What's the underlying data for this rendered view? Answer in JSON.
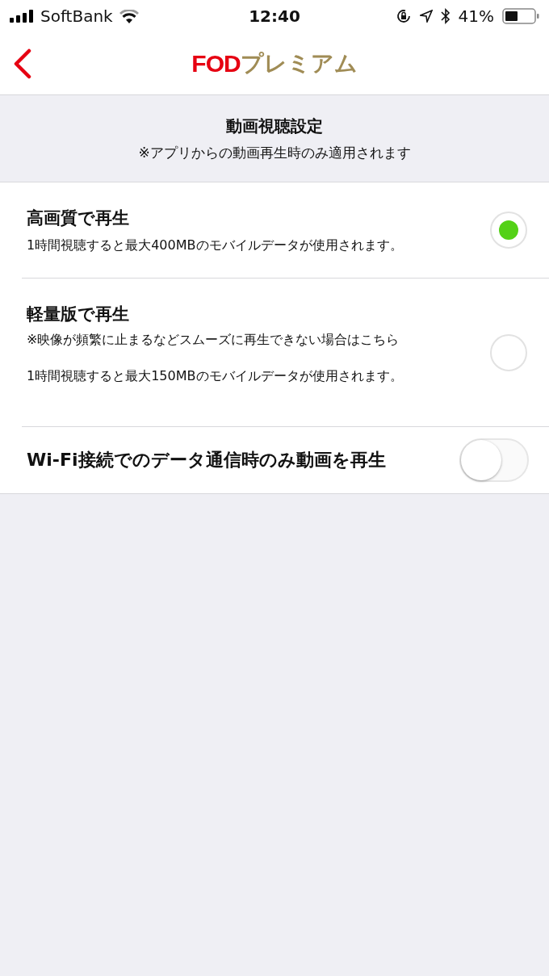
{
  "status_bar": {
    "carrier": "SoftBank",
    "time": "12:40",
    "battery": "41%"
  },
  "nav": {
    "logo_brand": "FOD",
    "logo_suffix": "プレミアム"
  },
  "section": {
    "title": "動画視聴設定",
    "subtitle": "※アプリからの動画再生時のみ適用されます"
  },
  "options": [
    {
      "kind": "radio",
      "label": "高画質で再生",
      "description": "1時間視聴すると最大400MBのモバイルデータが使用されます。",
      "selected": true
    },
    {
      "kind": "radio",
      "label": "軽量版で再生",
      "note": "※映像が頻繁に止まるなどスムーズに再生できない場合はこちら",
      "description": "1時間視聴すると最大150MBのモバイルデータが使用されます。",
      "selected": false
    },
    {
      "kind": "toggle",
      "label": "Wi-Fi接続でのデータ通信時のみ動画を再生",
      "on": false
    }
  ]
}
